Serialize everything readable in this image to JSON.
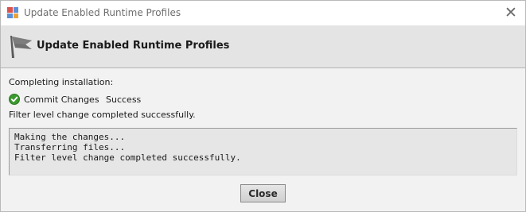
{
  "window": {
    "title": "Update Enabled Runtime Profiles",
    "close_glyph": "✕",
    "app_icon": "app-icon"
  },
  "header": {
    "title": "Update Enabled Runtime Profiles",
    "icon": "flag-icon"
  },
  "status": {
    "label": "Completing installation:",
    "results": [
      {
        "name": "Commit Changes",
        "state": "Success",
        "icon": "check-circle-icon"
      }
    ],
    "final_message": "Filter level change completed successfully."
  },
  "log": {
    "lines": [
      "Making the changes...",
      "Transferring files...",
      "Filter level change completed successfully."
    ]
  },
  "footer": {
    "close_label": "Close"
  },
  "colors": {
    "header_bg": "#e4e4e4",
    "dialog_bg": "#f2f2f2",
    "success_green": "#3a9a2e"
  }
}
